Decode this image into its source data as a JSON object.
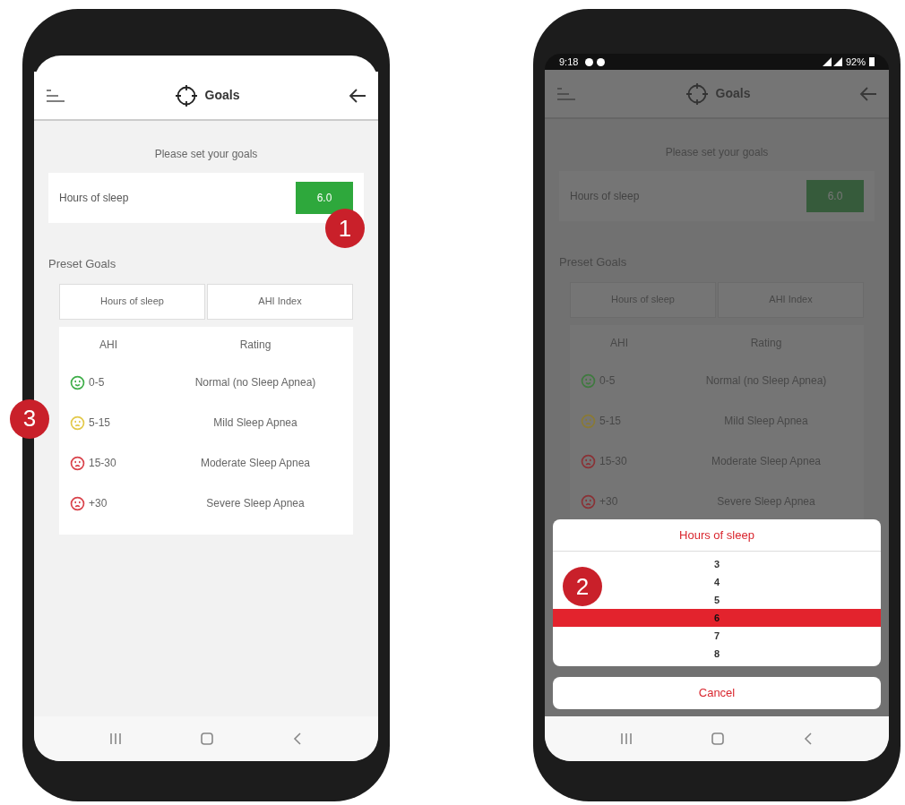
{
  "phones": [
    {
      "dimmed": false,
      "header": {
        "title": "Goals"
      },
      "prompt": "Please set your goals",
      "goal": {
        "label": "Hours of sleep",
        "value": "6.0",
        "callout": "1"
      },
      "preset_title": "Preset Goals",
      "preset_tabs": [
        {
          "label": "Hours of sleep"
        },
        {
          "label": "AHI Index"
        }
      ],
      "table": {
        "columns": [
          "AHI",
          "Rating"
        ],
        "rows": [
          {
            "ahi": "0-5",
            "rating": "Normal (no Sleep Apnea)",
            "kind": "happy",
            "color": "#3fae49"
          },
          {
            "ahi": "5-15",
            "rating": "Mild Sleep Apnea",
            "kind": "sad",
            "color": "#e3c94a",
            "callout": "3"
          },
          {
            "ahi": "15-30",
            "rating": "Moderate Sleep Apnea",
            "kind": "upset",
            "color": "#d9434b"
          },
          {
            "ahi": "+30",
            "rating": "Severe Sleep Apnea",
            "kind": "upset",
            "color": "#d9434b"
          }
        ]
      }
    },
    {
      "status_bar": {
        "time": "9:18",
        "battery": "92%"
      },
      "dimmed": true,
      "header": {
        "title": "Goals"
      },
      "prompt": "Please set your goals",
      "goal": {
        "label": "Hours of sleep",
        "value": "6.0"
      },
      "preset_title": "Preset Goals",
      "preset_tabs": [
        {
          "label": "Hours of sleep"
        },
        {
          "label": "AHI Index"
        }
      ],
      "table": {
        "columns": [
          "AHI",
          "Rating"
        ],
        "rows": [
          {
            "ahi": "0-5",
            "rating": "Normal (no Sleep Apnea)",
            "kind": "happy",
            "color": "#3f7a3f"
          },
          {
            "ahi": "5-15",
            "rating": "Mild Sleep Apnea",
            "kind": "sad",
            "color": "#8a7a35"
          },
          {
            "ahi": "15-30",
            "rating": "Moderate Sleep Apnea",
            "kind": "upset",
            "color": "#8a3236"
          },
          {
            "ahi": "+30",
            "rating": "Severe Sleep Apnea",
            "kind": "upset",
            "color": "#8a3236"
          }
        ]
      },
      "picker": {
        "title": "Hours of sleep",
        "callout": "2",
        "options": [
          {
            "label": "3",
            "selected": false
          },
          {
            "label": "4",
            "selected": false
          },
          {
            "label": "5",
            "selected": false
          },
          {
            "label": "6",
            "selected": true
          },
          {
            "label": "7",
            "selected": false
          },
          {
            "label": "8",
            "selected": false
          }
        ],
        "cancel": "Cancel"
      }
    }
  ]
}
